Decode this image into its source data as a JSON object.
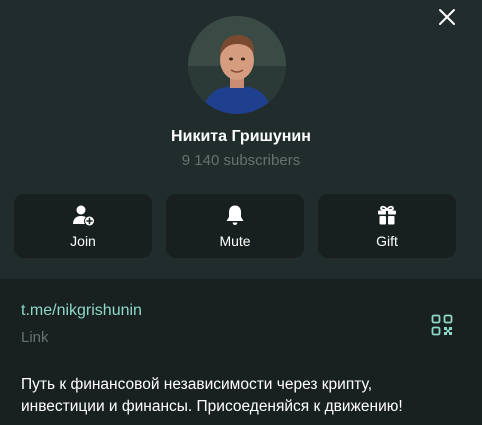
{
  "channel": {
    "name": "Никита Гришунин",
    "subscribers": "9 140 subscribers"
  },
  "actions": [
    {
      "label": "Join",
      "icon": "add-user-icon"
    },
    {
      "label": "Mute",
      "icon": "bell-icon"
    },
    {
      "label": "Gift",
      "icon": "gift-icon"
    }
  ],
  "info": {
    "link": "t.me/nikgrishunin",
    "link_caption": "Link",
    "description_line1": "Путь к финансовой независимости через крипту,",
    "description_line2": "инвестиции и финансы. Присоеденяйся к движению!"
  },
  "colors": {
    "background": "#212d2c",
    "panel": "#182120",
    "button": "#17201f",
    "accent": "#8ed8c8",
    "muted": "#65736f"
  }
}
